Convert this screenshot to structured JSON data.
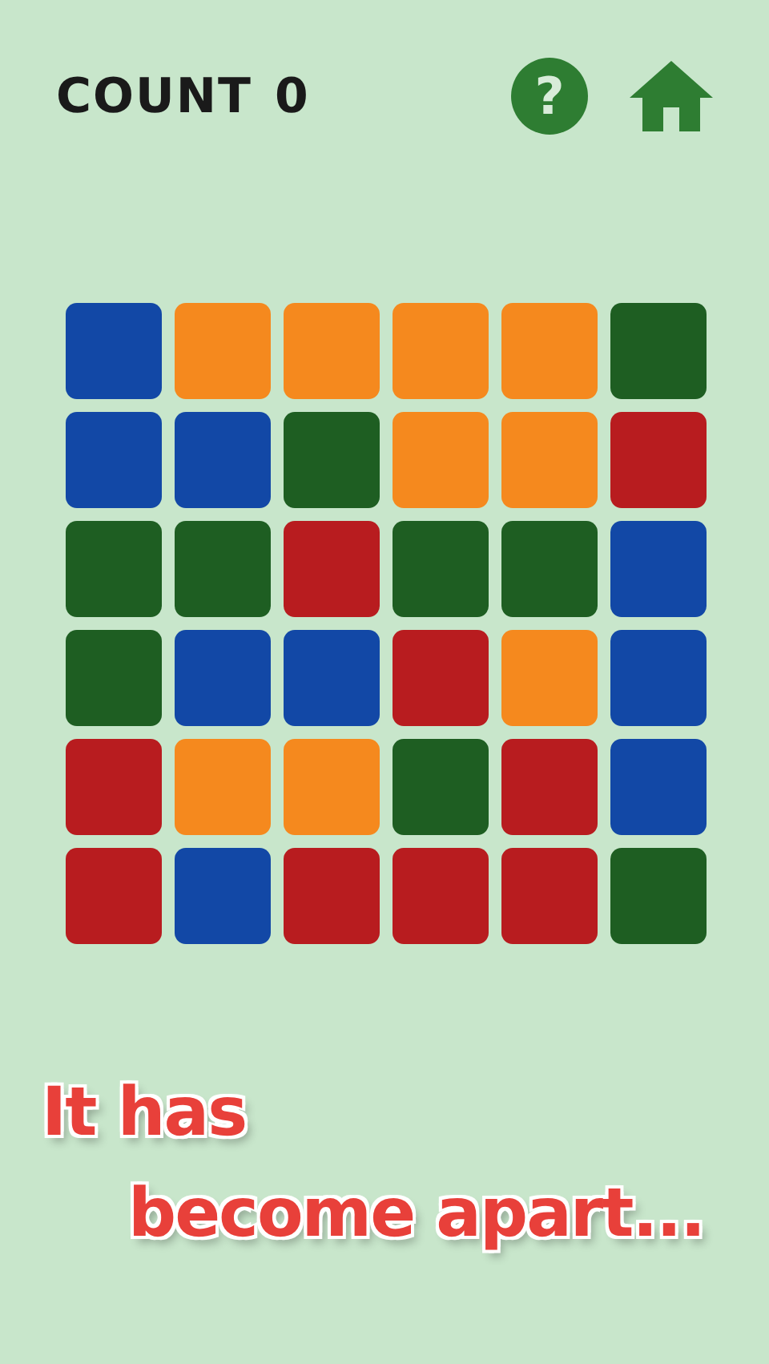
{
  "header": {
    "count_label": "COUNT",
    "count_value": "0",
    "help_button": "?"
  },
  "board": {
    "rows": [
      {
        "tiles": [
          {
            "color": "#1248a6"
          },
          {
            "color": "#f5891e"
          },
          {
            "color": "#f5891e"
          },
          {
            "color": "#f5891e"
          },
          {
            "color": "#f5891e"
          },
          {
            "color": "#1e5e22"
          }
        ]
      },
      {
        "tiles": [
          {
            "color": "#1248a6"
          },
          {
            "color": "#1248a6"
          },
          {
            "color": "#1e5e22"
          },
          {
            "color": "#f5891e"
          },
          {
            "color": "#f5891e"
          },
          {
            "color": "#b81c1f"
          }
        ]
      },
      {
        "tiles": [
          {
            "color": "#1e5e22"
          },
          {
            "color": "#1e5e22"
          },
          {
            "color": "#b81c1f"
          },
          {
            "color": "#1e5e22"
          },
          {
            "color": "#1e5e22"
          },
          {
            "color": "#1248a6"
          }
        ]
      },
      {
        "tiles": [
          {
            "color": "#1e5e22"
          },
          {
            "color": "#1248a6"
          },
          {
            "color": "#1248a6"
          },
          {
            "color": "#b81c1f"
          },
          {
            "color": "#f5891e"
          },
          {
            "color": "#1248a6"
          }
        ]
      },
      {
        "tiles": [
          {
            "color": "#b81c1f"
          },
          {
            "color": "#f5891e"
          },
          {
            "color": "#f5891e"
          },
          {
            "color": "#1e5e22"
          },
          {
            "color": "#b81c1f"
          },
          {
            "color": "#1248a6"
          }
        ]
      },
      {
        "tiles": [
          {
            "color": "#b81c1f"
          },
          {
            "color": "#1248a6"
          },
          {
            "color": "#b81c1f"
          },
          {
            "color": "#b81c1f"
          },
          {
            "color": "#b81c1f"
          },
          {
            "color": "#1e5e22"
          }
        ]
      }
    ]
  },
  "caption": {
    "lines": [
      "It has",
      "become apart..."
    ]
  }
}
